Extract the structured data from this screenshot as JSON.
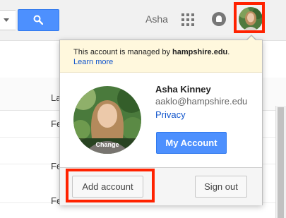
{
  "header": {
    "user_name": "Asha",
    "search_icon": "search-icon",
    "apps_icon": "apps-grid-icon",
    "notifications_icon": "notifications-bell-icon"
  },
  "list": {
    "column_header": "La",
    "rows": [
      "Fe",
      "Fe",
      "Fe"
    ]
  },
  "account_popup": {
    "notice_prefix": "This account is managed by ",
    "notice_domain": "hampshire.edu",
    "notice_suffix": ".",
    "learn_more": "Learn more",
    "change_photo_label": "Change",
    "full_name": "Asha Kinney",
    "email": "aaklo@hampshire.edu",
    "privacy_link": "Privacy",
    "my_account_button": "My Account",
    "add_account_button": "Add account",
    "sign_out_button": "Sign out"
  },
  "colors": {
    "primary_blue": "#4d90fe",
    "link_blue": "#1155cc",
    "notice_bg": "#fff8dd",
    "highlight_red": "#ff2200"
  }
}
